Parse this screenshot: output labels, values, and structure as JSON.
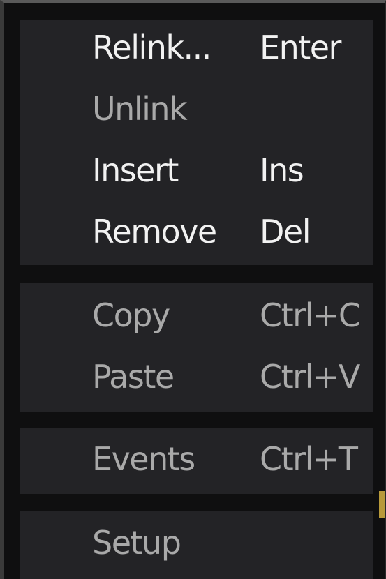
{
  "menu": {
    "group1": {
      "relink": {
        "label": "Relink...",
        "shortcut": "Enter"
      },
      "unlink": {
        "label": "Unlink",
        "shortcut": ""
      },
      "insert": {
        "label": "Insert",
        "shortcut": "Ins"
      },
      "remove": {
        "label": "Remove",
        "shortcut": "Del"
      }
    },
    "group2": {
      "copy": {
        "label": "Copy",
        "shortcut": "Ctrl+C"
      },
      "paste": {
        "label": "Paste",
        "shortcut": "Ctrl+V"
      }
    },
    "group3": {
      "events": {
        "label": "Events",
        "shortcut": "Ctrl+T"
      }
    },
    "group4": {
      "setup": {
        "label": "Setup"
      }
    }
  },
  "colors": {
    "menu_background": "#0f0f10",
    "group_background": "#232326",
    "enabled_text": "#f2f2f2",
    "secondary_text": "#a9a9a9"
  }
}
